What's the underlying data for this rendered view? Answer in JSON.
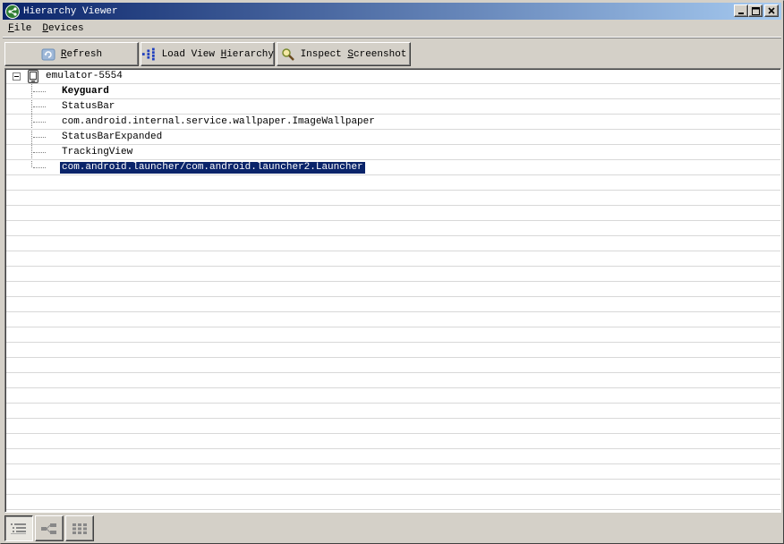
{
  "window": {
    "title": "Hierarchy Viewer",
    "minimize": "_",
    "maximize": "□",
    "close": "×"
  },
  "menu": {
    "file": {
      "hotkey": "F",
      "rest": "ile"
    },
    "devices": {
      "hotkey": "D",
      "rest": "evices"
    }
  },
  "toolbar": {
    "refresh": {
      "hotkey": "R",
      "rest": "efresh"
    },
    "load_view": {
      "pre": "Load View ",
      "hotkey": "H",
      "rest": "ierarchy"
    },
    "inspect": {
      "pre": "Inspect ",
      "hotkey": "S",
      "rest": "creenshot"
    }
  },
  "tree": {
    "device": "emulator-5554",
    "windows": [
      {
        "label": "Keyguard",
        "bold": true,
        "selected": false
      },
      {
        "label": "StatusBar",
        "bold": false,
        "selected": false
      },
      {
        "label": "com.android.internal.service.wallpaper.ImageWallpaper",
        "bold": false,
        "selected": false
      },
      {
        "label": "StatusBarExpanded",
        "bold": false,
        "selected": false
      },
      {
        "label": "TrackingView",
        "bold": false,
        "selected": false
      },
      {
        "label": "com.android.launcher/com.android.launcher2.Launcher",
        "bold": false,
        "selected": true
      }
    ]
  },
  "statusbar": {
    "views": [
      {
        "icon": "list-view-icon",
        "pressed": true
      },
      {
        "icon": "tree-view-icon",
        "pressed": false
      },
      {
        "icon": "grid-view-icon",
        "pressed": false
      }
    ]
  },
  "colors": {
    "titlebar_start": "#0a246a",
    "titlebar_end": "#a6caf0",
    "selection": "#0a246a",
    "chrome": "#d4d0c8"
  }
}
